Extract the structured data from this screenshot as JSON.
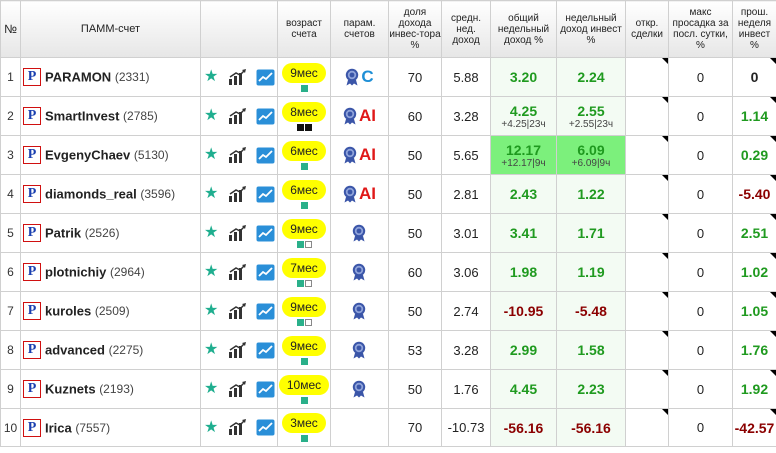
{
  "headers": {
    "num": "№",
    "account": "ПАММ-счет",
    "age": "возраст счета",
    "params": "парам. счетов",
    "share": "доля дохода инвес-тора %",
    "avg_weekly": "средн. нед. доход",
    "total_weekly": "общий недельный доход %",
    "investor_weekly": "недельный доход инвест %",
    "open_deals": "откр. сделки",
    "max_drawdown": "макс просадка за посл. сутки, %",
    "last_week": "прош. неделя инвест %"
  },
  "colors": {
    "positive": "#1f9a1f",
    "negative": "#8b0000",
    "highlight": "#7cf07c",
    "age_badge": "#ffff00",
    "accent_teal": "#1fae8f"
  },
  "rows": [
    {
      "n": "1",
      "name": "PARAMON",
      "id": "(2331)",
      "age": "9мес",
      "age_squares": [
        "green"
      ],
      "medal": true,
      "tag": "C",
      "share": "70",
      "avg": "5.88",
      "total": "3.20",
      "total_sub": "",
      "total_sign": "pos",
      "inv": "2.24",
      "inv_sub": "",
      "inv_sign": "pos",
      "highlight": false,
      "open": "",
      "dd": "0",
      "last": "0",
      "last_sign": "neutral"
    },
    {
      "n": "2",
      "name": "SmartInvest",
      "id": "(2785)",
      "age": "8мес",
      "age_squares": [
        "black",
        "black"
      ],
      "medal": true,
      "tag": "AI",
      "share": "60",
      "avg": "3.28",
      "total": "4.25",
      "total_sub": "+4.25|23ч",
      "total_sign": "pos",
      "inv": "2.55",
      "inv_sub": "+2.55|23ч",
      "inv_sign": "pos",
      "highlight": false,
      "open": "",
      "dd": "0",
      "last": "1.14",
      "last_sign": "pos"
    },
    {
      "n": "3",
      "name": "EvgenyChaev",
      "id": "(5130)",
      "age": "6мес",
      "age_squares": [
        "green"
      ],
      "medal": true,
      "tag": "AI",
      "share": "50",
      "avg": "5.65",
      "total": "12.17",
      "total_sub": "+12.17|9ч",
      "total_sign": "pos",
      "inv": "6.09",
      "inv_sub": "+6.09|9ч",
      "inv_sign": "pos",
      "highlight": true,
      "open": "",
      "dd": "0",
      "last": "0.29",
      "last_sign": "pos"
    },
    {
      "n": "4",
      "name": "diamonds_real",
      "id": "(3596)",
      "age": "6мес",
      "age_squares": [
        "green"
      ],
      "medal": true,
      "tag": "AI",
      "share": "50",
      "avg": "2.81",
      "total": "2.43",
      "total_sub": "",
      "total_sign": "pos",
      "inv": "1.22",
      "inv_sub": "",
      "inv_sign": "pos",
      "highlight": false,
      "open": "",
      "dd": "0",
      "last": "-5.40",
      "last_sign": "neg"
    },
    {
      "n": "5",
      "name": "Patrik",
      "id": "(2526)",
      "age": "9мес",
      "age_squares": [
        "green",
        "empty"
      ],
      "medal": true,
      "tag": "",
      "share": "50",
      "avg": "3.01",
      "total": "3.41",
      "total_sub": "",
      "total_sign": "pos",
      "inv": "1.71",
      "inv_sub": "",
      "inv_sign": "pos",
      "highlight": false,
      "open": "",
      "dd": "0",
      "last": "2.51",
      "last_sign": "pos"
    },
    {
      "n": "6",
      "name": "plotnichiy",
      "id": "(2964)",
      "age": "7мес",
      "age_squares": [
        "green",
        "empty"
      ],
      "medal": true,
      "tag": "",
      "share": "60",
      "avg": "3.06",
      "total": "1.98",
      "total_sub": "",
      "total_sign": "pos",
      "inv": "1.19",
      "inv_sub": "",
      "inv_sign": "pos",
      "highlight": false,
      "open": "",
      "dd": "0",
      "last": "1.02",
      "last_sign": "pos"
    },
    {
      "n": "7",
      "name": "kuroles",
      "id": "(2509)",
      "age": "9мес",
      "age_squares": [
        "green",
        "empty"
      ],
      "medal": true,
      "tag": "",
      "share": "50",
      "avg": "2.74",
      "total": "-10.95",
      "total_sub": "",
      "total_sign": "neg",
      "inv": "-5.48",
      "inv_sub": "",
      "inv_sign": "neg",
      "highlight": false,
      "open": "",
      "dd": "0",
      "last": "1.05",
      "last_sign": "pos"
    },
    {
      "n": "8",
      "name": "advanced",
      "id": "(2275)",
      "age": "9мес",
      "age_squares": [
        "green"
      ],
      "medal": true,
      "tag": "",
      "share": "53",
      "avg": "3.28",
      "total": "2.99",
      "total_sub": "",
      "total_sign": "pos",
      "inv": "1.58",
      "inv_sub": "",
      "inv_sign": "pos",
      "highlight": false,
      "open": "",
      "dd": "0",
      "last": "1.76",
      "last_sign": "pos"
    },
    {
      "n": "9",
      "name": "Kuznets",
      "id": "(2193)",
      "age": "10мес",
      "age_squares": [
        "green"
      ],
      "medal": true,
      "tag": "",
      "share": "50",
      "avg": "1.76",
      "total": "4.45",
      "total_sub": "",
      "total_sign": "pos",
      "inv": "2.23",
      "inv_sub": "",
      "inv_sign": "pos",
      "highlight": false,
      "open": "",
      "dd": "0",
      "last": "1.92",
      "last_sign": "pos"
    },
    {
      "n": "10",
      "name": "Irica",
      "id": "(7557)",
      "age": "3мес",
      "age_squares": [
        "green"
      ],
      "medal": false,
      "tag": "",
      "share": "70",
      "avg": "-10.73",
      "total": "-56.16",
      "total_sub": "",
      "total_sign": "neg",
      "inv": "-56.16",
      "inv_sub": "",
      "inv_sign": "neg",
      "highlight": false,
      "open": "",
      "dd": "0",
      "last": "-42.57",
      "last_sign": "neg"
    }
  ]
}
